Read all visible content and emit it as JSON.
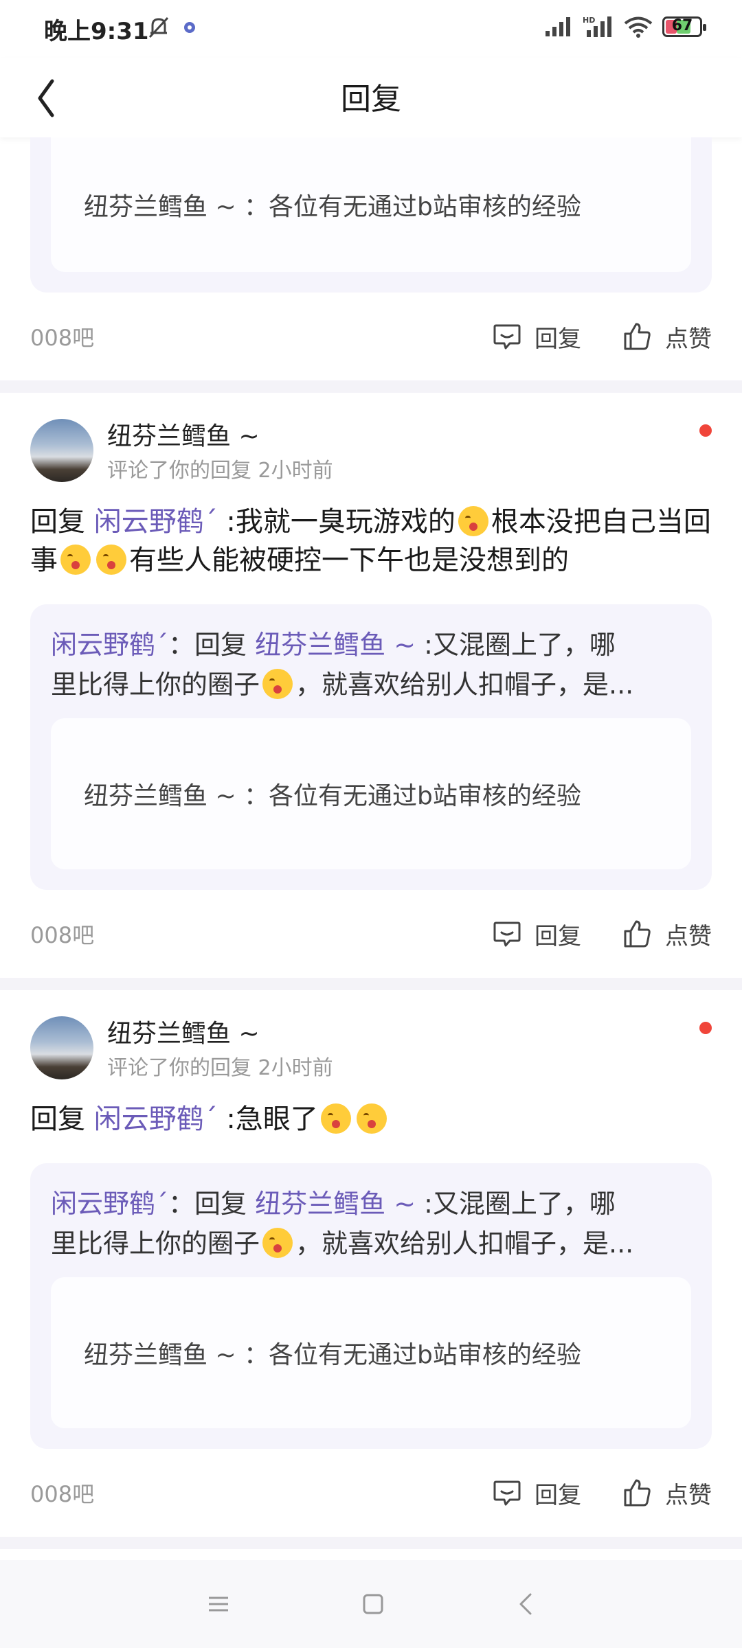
{
  "status_bar": {
    "time": "晚上9:31",
    "battery": "67",
    "network_label": "HD"
  },
  "nav": {
    "title": "回复"
  },
  "top_card": {
    "quoted_origin": "纽芬兰鳕鱼 ~ ：各位有无通过b站审核的经验",
    "source": "008吧",
    "reply_label": "回复",
    "like_label": "点赞"
  },
  "posts": [
    {
      "author": "纽芬兰鳕鱼 ~",
      "subline": "评论了你的回复  2小时前",
      "reply_prefix": "回复 ",
      "reply_target": "闲云野鹤ˊ",
      "text_a": " :我就一臭玩游戏的",
      "text_b": "根本没把自己当回事",
      "text_c": "有些人能被硬控一下午也是没想到的",
      "quote_author": "闲云野鹤ˊ",
      "quote_mid": "：回复 ",
      "quote_target": "纽芬兰鳕鱼 ~ ",
      "quote_text_a": " :又混圈上了，哪",
      "quote_text_b": "里比得上你的圈子",
      "quote_text_c": "，就喜欢给别人扣帽子，是...",
      "quoted_origin": "纽芬兰鳕鱼 ~ ：各位有无通过b站审核的经验",
      "source": "008吧",
      "reply_label": "回复",
      "like_label": "点赞"
    },
    {
      "author": "纽芬兰鳕鱼 ~",
      "subline": "评论了你的回复  2小时前",
      "reply_prefix": "回复 ",
      "reply_target": "闲云野鹤ˊ",
      "text_a": " :急眼了",
      "quote_author": "闲云野鹤ˊ",
      "quote_mid": "：回复 ",
      "quote_target": "纽芬兰鳕鱼 ~ ",
      "quote_text_a": " :又混圈上了，哪",
      "quote_text_b": "里比得上你的圈子",
      "quote_text_c": "，就喜欢给别人扣帽子，是...",
      "quoted_origin": "纽芬兰鳕鱼 ~ ：各位有无通过b站审核的经验",
      "source": "008吧",
      "reply_label": "回复",
      "like_label": "点赞"
    }
  ],
  "colors": {
    "link": "#6b5bb8",
    "quote_bg": "#f5f4fc",
    "red_dot": "#f0453a"
  }
}
